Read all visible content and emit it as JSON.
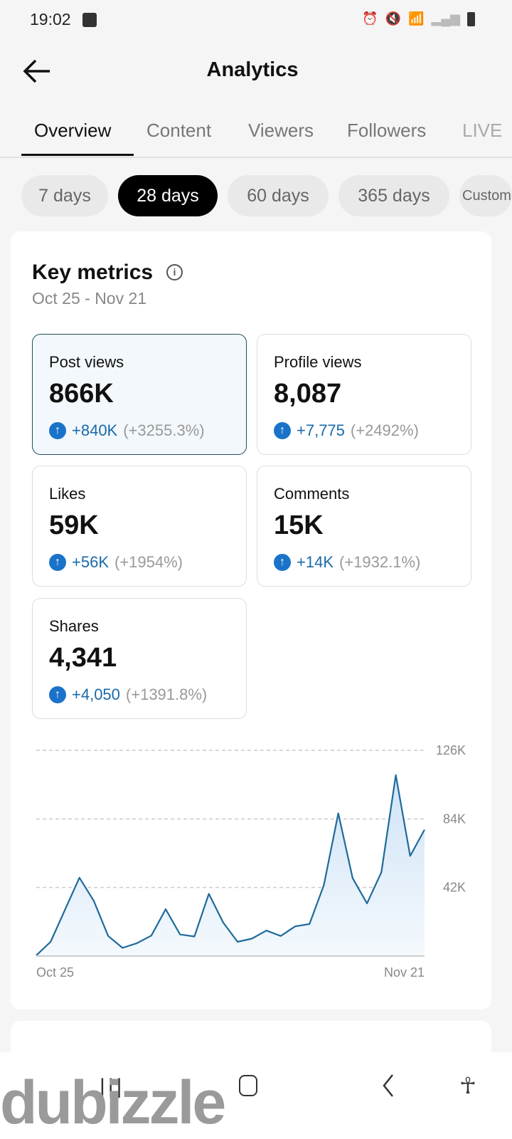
{
  "status_bar": {
    "time": "19:02",
    "icons": [
      "gallery-icon",
      "alarm-icon",
      "mute-icon",
      "wifi-icon",
      "signal-icon",
      "signal-icon",
      "battery-charging-icon"
    ]
  },
  "header": {
    "title": "Analytics"
  },
  "tabs": [
    {
      "label": "Overview",
      "active": true
    },
    {
      "label": "Content"
    },
    {
      "label": "Viewers"
    },
    {
      "label": "Followers"
    },
    {
      "label": "LIVE"
    }
  ],
  "ranges": [
    {
      "label": "7 days"
    },
    {
      "label": "28 days",
      "active": true
    },
    {
      "label": "60 days"
    },
    {
      "label": "365 days"
    },
    {
      "label": "Custom"
    }
  ],
  "key_metrics": {
    "title": "Key metrics",
    "date_range": "Oct 25 - Nov 21",
    "cards": [
      {
        "label": "Post views",
        "value": "866K",
        "delta": "+840K",
        "pct": "(+3255.3%)",
        "selected": true
      },
      {
        "label": "Profile views",
        "value": "8,087",
        "delta": "+7,775",
        "pct": "(+2492%)"
      },
      {
        "label": "Likes",
        "value": "59K",
        "delta": "+56K",
        "pct": "(+1954%)"
      },
      {
        "label": "Comments",
        "value": "15K",
        "delta": "+14K",
        "pct": "(+1932.1%)"
      },
      {
        "label": "Shares",
        "value": "4,341",
        "delta": "+4,050",
        "pct": "(+1391.8%)"
      }
    ]
  },
  "colors": {
    "accent": "#1a73c9",
    "line": "#1f6a9a",
    "selected_border": "#1f4f62"
  },
  "chart_data": {
    "type": "area",
    "x_tick_labels": [
      "Oct 25",
      "Nov 21"
    ],
    "y_ticks": [
      "126K",
      "84K",
      "42K"
    ],
    "y_tick_values": [
      126,
      84,
      42
    ],
    "ylim": [
      0,
      126
    ],
    "y_unit": "K",
    "grid": true,
    "values": [
      0.4,
      8.7,
      28.4,
      48.0,
      33.8,
      12.3,
      5.0,
      7.9,
      12.5,
      28.7,
      13.2,
      12.0,
      38.1,
      20.5,
      8.7,
      10.7,
      15.6,
      12.3,
      18.2,
      19.6,
      43.4,
      87.4,
      47.7,
      32.2,
      51.3,
      110.8,
      61.3,
      77.4
    ]
  },
  "watermark": "dubizzle"
}
